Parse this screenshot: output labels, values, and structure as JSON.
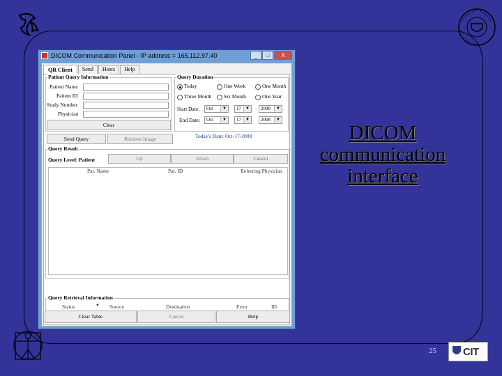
{
  "slide": {
    "title_lines": [
      "DICOM",
      "communication",
      "interface"
    ],
    "page_number": "25",
    "cit_logo_text": "CIT"
  },
  "app": {
    "window_title": "DICOM Communication Panel - IP address = 165.112.97.40",
    "window_buttons": [
      "_",
      "□",
      "X"
    ],
    "tabs": [
      "QR Client",
      "Send",
      "Hosts",
      "Help"
    ],
    "patient_query": {
      "label": "Patient Query Information",
      "fields": [
        {
          "label": "Patient Name",
          "value": ""
        },
        {
          "label": "Patient ID",
          "value": ""
        },
        {
          "label": "Study Number",
          "value": ""
        },
        {
          "label": "Physician",
          "value": ""
        }
      ],
      "clear_label": "Clear"
    },
    "query_duration": {
      "label": "Query Duration",
      "options": [
        "Today",
        "One Week",
        "One Month",
        "Three Month",
        "Six Month",
        "One Year"
      ],
      "selected": "Today",
      "start_label": "Start Date:",
      "end_label": "End Date:",
      "start_date": {
        "month": "Oct",
        "day": "17",
        "year": "2008"
      },
      "end_date": {
        "month": "Oct",
        "day": "17",
        "year": "2008"
      },
      "todays_date": "Today's Date: Oct-17-2008"
    },
    "actions": {
      "send_query": "Send Query",
      "retrieve_image": "Retrieve Image"
    },
    "query_result": {
      "label": "Query Result",
      "level": "Query Level: Patient",
      "up": "Up",
      "down": "Down",
      "cancel": "Cancel",
      "columns": [
        "Pat. Name",
        "Pat. ID",
        "Referring Physician"
      ]
    },
    "retrieval": {
      "label": "Query Retrieval Information",
      "columns": [
        "Status",
        "Source",
        "Destination",
        "Error",
        "ID"
      ]
    },
    "bottom": {
      "clear_table": "Clear Table",
      "cancel": "Cancel",
      "help": "Help"
    }
  }
}
